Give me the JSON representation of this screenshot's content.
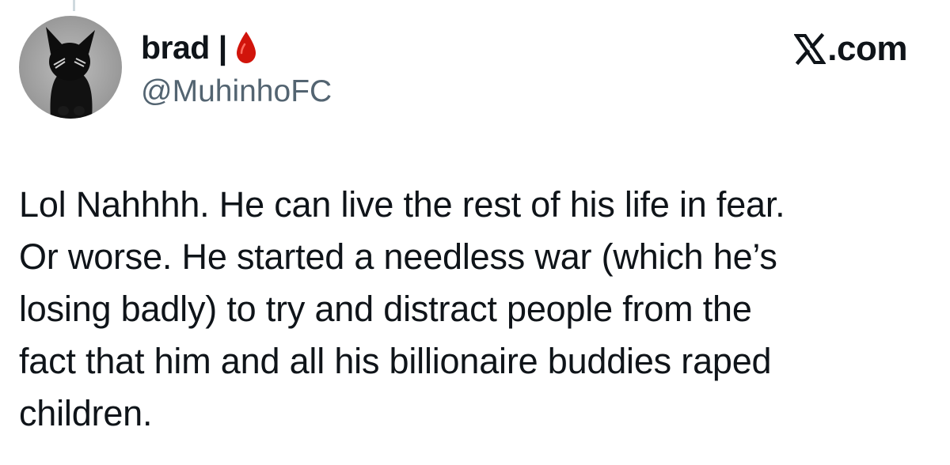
{
  "tweet": {
    "author": {
      "display_name": "brad |",
      "handle": "@MuhinhoFC",
      "badge_icon": "blood-drop-icon",
      "avatar_icon": "black-cat-avatar"
    },
    "brand": {
      "logo_icon": "x-logo-icon",
      "text": ".com"
    },
    "body": "Lol Nahhhh. He can live the rest of his life in fear.\nOr worse. He started a needless war (which he’s\nlosing badly) to try and distract people from the\nfact that him and all his billionaire buddies raped\nchildren."
  },
  "colors": {
    "text_primary": "#0f1419",
    "text_secondary": "#536471",
    "blood_red": "#d1140b",
    "background": "#ffffff"
  }
}
